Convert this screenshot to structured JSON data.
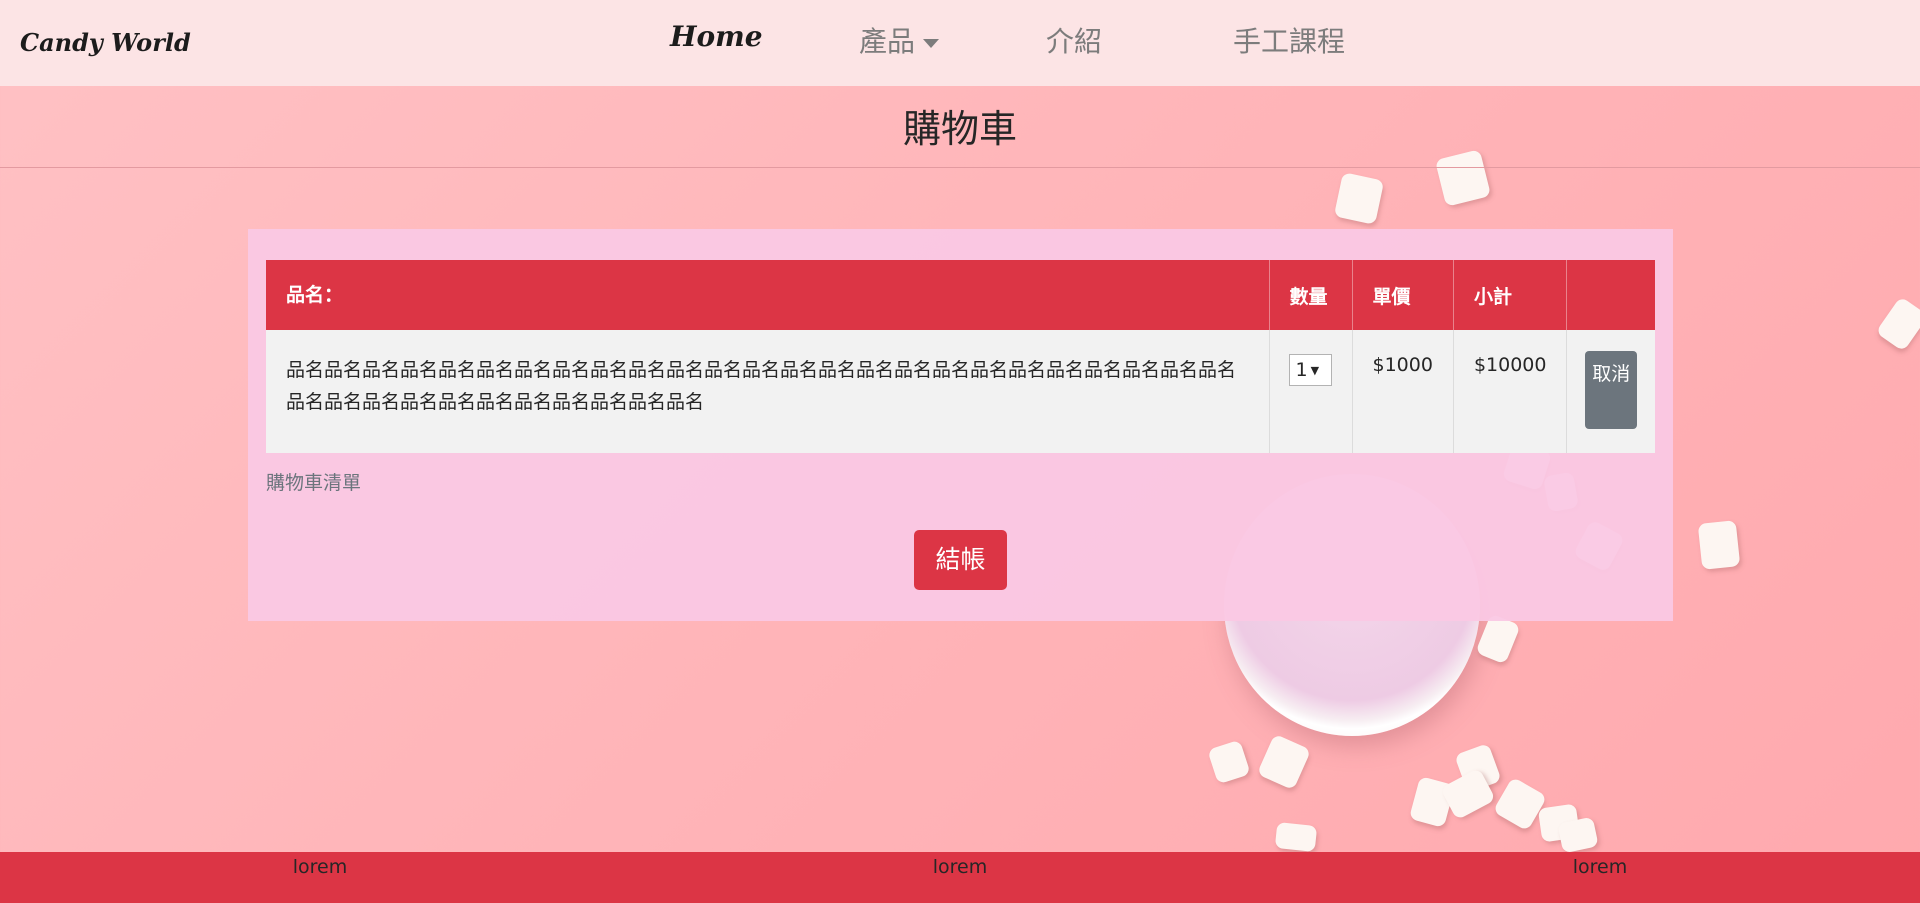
{
  "navbar": {
    "brand": "Candy World",
    "items": [
      {
        "label": "Home",
        "active": true
      },
      {
        "label": "產品",
        "dropdown": true
      },
      {
        "label": "介紹"
      },
      {
        "label": "手工課程"
      }
    ]
  },
  "page": {
    "title": "購物車"
  },
  "cart": {
    "headers": {
      "name": "品名：",
      "quantity": "數量",
      "unit_price": "單價",
      "subtotal": "小計"
    },
    "rows": [
      {
        "name": "品名品名品名品名品名品名品名品名品名品名品名品名品名品名品名品名品名品名品名品名品名品名品名品名品名品名品名品名品名品名品名品名品名品名品名品名",
        "quantity": "1",
        "unit_price": "$1000",
        "subtotal": "$10000",
        "cancel_label": "取消"
      }
    ],
    "caption": "購物車清單",
    "checkout_label": "結帳"
  },
  "footer": {
    "items": [
      "lorem",
      "lorem",
      "lorem"
    ]
  },
  "colors": {
    "accent": "#dc3545",
    "secondary": "#6c757d",
    "navbar_bg": "#fce4e5",
    "panel_bg": "#fac8e4"
  }
}
